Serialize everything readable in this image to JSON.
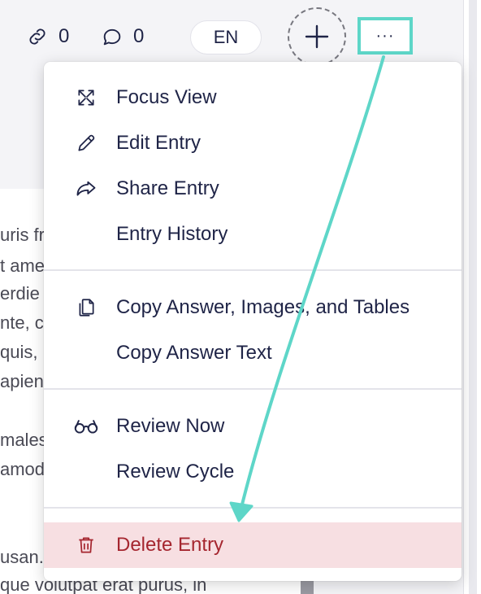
{
  "header": {
    "links_count": "0",
    "comments_count": "0",
    "language": "EN",
    "more_label": "···"
  },
  "content_lines": [
    "uris fr",
    "t ame",
    "erdie",
    "nte, c",
    "quis,",
    "apien",
    "",
    "males",
    "amod",
    "",
    "",
    "usan. S",
    "que volutpat erat purus, in"
  ],
  "menu": {
    "items": [
      {
        "label": "Focus View",
        "icon": "expand-icon"
      },
      {
        "label": "Edit Entry",
        "icon": "pencil-icon"
      },
      {
        "label": "Share Entry",
        "icon": "share-icon"
      },
      {
        "label": "Entry History",
        "icon": ""
      },
      {
        "label": "Copy Answer, Images, and Tables",
        "icon": "copy-icon"
      },
      {
        "label": "Copy Answer Text",
        "icon": ""
      },
      {
        "label": "Review Now",
        "icon": "glasses-icon"
      },
      {
        "label": "Review Cycle",
        "icon": ""
      },
      {
        "label": "Delete Entry",
        "icon": "trash-icon"
      }
    ]
  },
  "colors": {
    "highlight": "#5ed6c8",
    "danger_bg": "#f7dfe2",
    "danger_text": "#a5262f",
    "text": "#1f2447"
  }
}
